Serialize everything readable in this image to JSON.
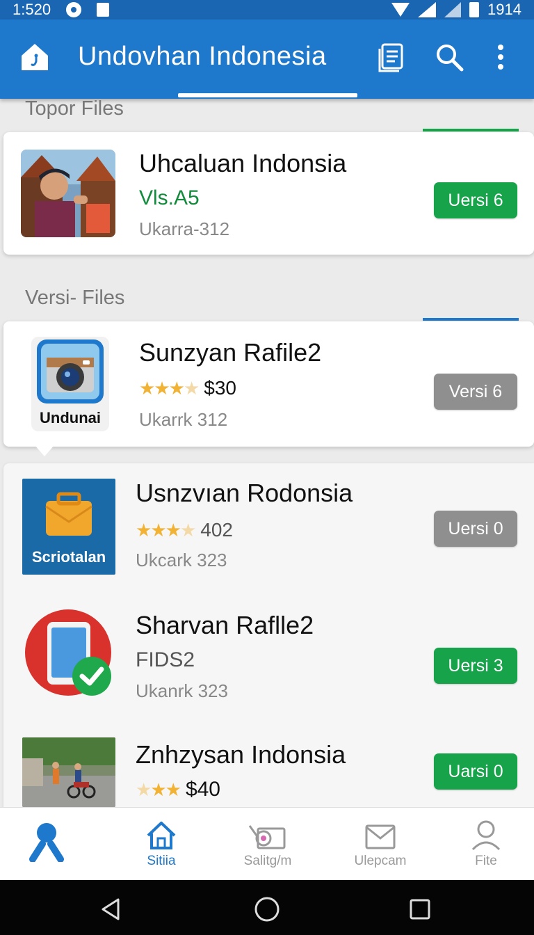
{
  "status_bar": {
    "time": "1:520",
    "battery_text": "1914"
  },
  "app_bar": {
    "title": "Undovhan Indonesia"
  },
  "sections": {
    "top": {
      "title": "Topor Files",
      "accent_color": "#16a34a"
    },
    "versi": {
      "title": "Versi- Files",
      "accent_color": "#1e78cc"
    }
  },
  "top_file": {
    "title": "Uhcaluan Indonsia",
    "subtitle": "Vls.A5",
    "meta": "Ukarra-312",
    "button": "Uersi 6"
  },
  "versi_files": [
    {
      "title": "Sunzyan Rafile2",
      "rating": 3.5,
      "price": "$30",
      "meta": "Ukarrk 312",
      "button": "Versi 6",
      "icon_label": "Undunai",
      "button_state": "disabled"
    },
    {
      "title": "Usnzvıan Rodonsia",
      "rating": 3.5,
      "price": "402",
      "meta": "Ukcark 323",
      "button": "Uersi 0",
      "icon_label": "Scriotalan",
      "button_state": "disabled"
    },
    {
      "title": "Sharvan Raflle2",
      "subtitle": "FIDS2",
      "meta": "Ukanrk 323",
      "button": "Uersi 3",
      "button_state": "enabled"
    },
    {
      "title": "Znhzysan Indonsia",
      "rating": 3,
      "price": "$40",
      "button": "Uarsi 0",
      "button_state": "enabled"
    }
  ],
  "bottom_nav": [
    {
      "label": "",
      "icon": "people-icon"
    },
    {
      "label": "Sitiia",
      "icon": "home-icon",
      "active": true
    },
    {
      "label": "Salitg/m",
      "icon": "camera-icon"
    },
    {
      "label": "Ulepcam",
      "icon": "mail-icon"
    },
    {
      "label": "Fite",
      "icon": "person-icon"
    }
  ],
  "colors": {
    "primary": "#1e78cc",
    "green": "#16a34a",
    "grey_button": "#8f8f8f"
  }
}
